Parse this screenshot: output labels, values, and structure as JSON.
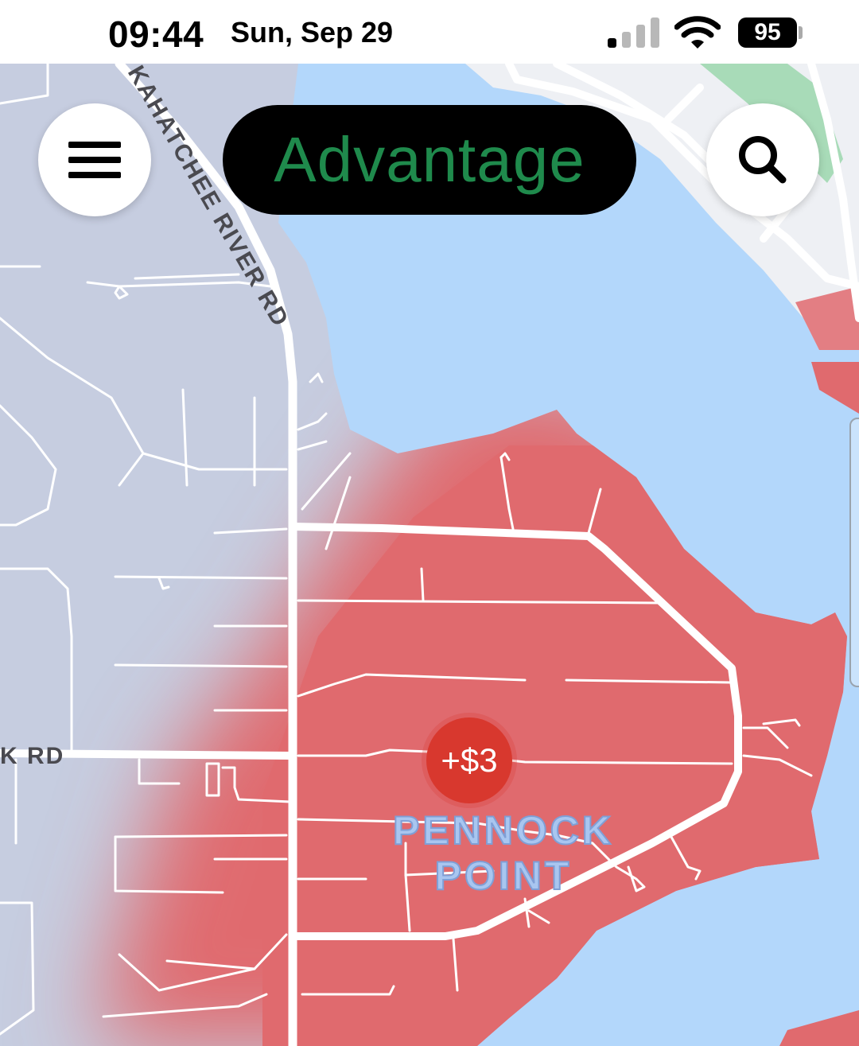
{
  "status_bar": {
    "time": "09:44",
    "date": "Sun, Sep 29",
    "battery_level": "95",
    "signal_icon": "cellular-signal-icon",
    "wifi_icon": "wifi-icon"
  },
  "header": {
    "menu_icon": "hamburger-menu-icon",
    "mode_label": "Advantage",
    "mode_label_color": "#1f8a4c",
    "search_icon": "search-icon"
  },
  "map": {
    "road_labels": {
      "river_road": "KAHATCHEE RIVER RD",
      "k_road": "K RD"
    },
    "area_label_line1": "PENNOCK",
    "area_label_line2": "POINT",
    "surge_badge": "+$3",
    "colors": {
      "land": "#c6cde0",
      "water": "#b3d7fb",
      "surge_zone": "#e06a6e",
      "park": "#a8dbb8",
      "road": "#ffffff",
      "surge_badge": "#d8382e"
    }
  }
}
